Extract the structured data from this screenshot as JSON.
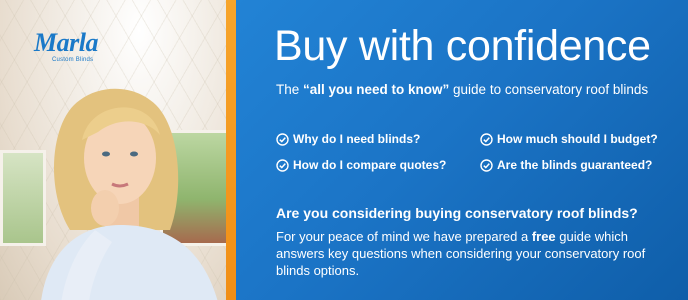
{
  "logo": {
    "word": "Marla",
    "sub": "Custom Blinds"
  },
  "headline": "Buy with confidence",
  "subline": {
    "pre": "The ",
    "emph": "“all you need to know”",
    "post": " guide to conservatory roof blinds"
  },
  "checklist": [
    "Why do I need blinds?",
    "How much should I budget?",
    "How do I compare quotes?",
    "Are the blinds guaranteed?"
  ],
  "question": "Are you considering buying conservatory roof blinds?",
  "body": {
    "pre": "For your peace of mind we have prepared a ",
    "emph": "free",
    "post": " guide which answers key questions when considering your conservatory roof blinds options."
  },
  "colors": {
    "panel_blue": "#1b74c6",
    "accent_orange": "#f18e15",
    "logo_blue": "#1a79c8"
  },
  "icons": {
    "check": "check-circle-icon"
  }
}
